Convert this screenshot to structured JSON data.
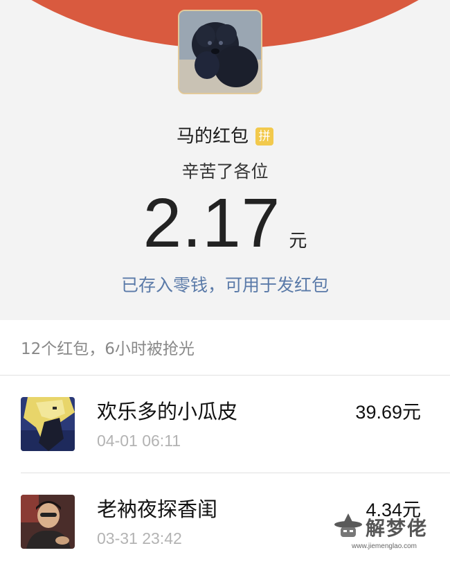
{
  "header": {
    "sender_name": "马的红包",
    "pin_badge": "拼",
    "greeting": "辛苦了各位",
    "amount": "2.17",
    "amount_unit": "元",
    "saved_link": "已存入零钱，可用于发红包",
    "arc_color": "#d95a3f"
  },
  "summary": "12个红包，6小时被抢光",
  "records": [
    {
      "name": "欢乐多的小瓜皮",
      "time": "04-01 06:11",
      "amount": "39.69元",
      "avatar": "anime-character-avatar"
    },
    {
      "name": "老衲夜探香闺",
      "time": "03-31 23:42",
      "amount": "4.34元",
      "avatar": "person-photo-avatar"
    }
  ],
  "watermark": {
    "title": "解梦佬",
    "url": "www.jiemenglao.com"
  }
}
